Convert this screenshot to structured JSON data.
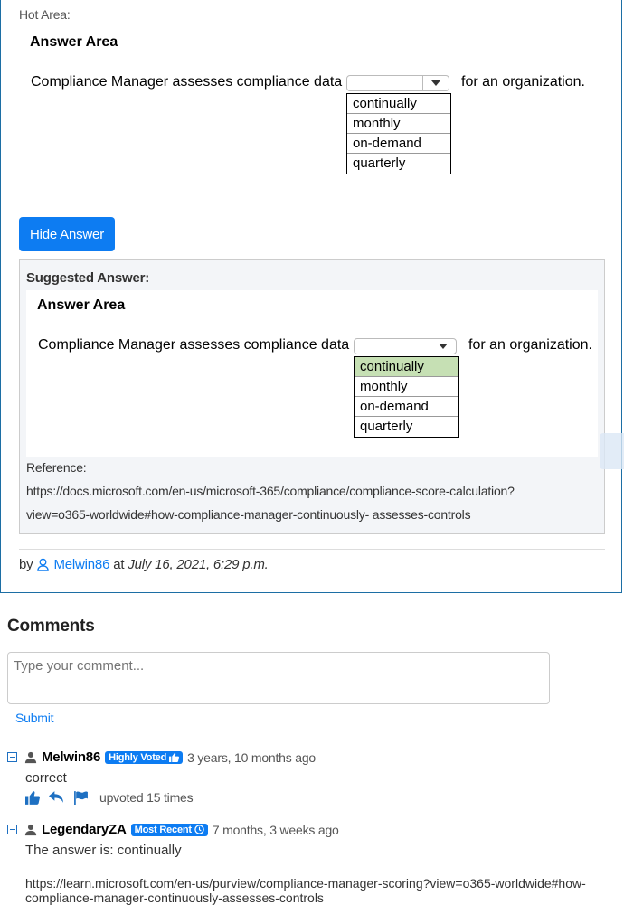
{
  "question": {
    "hot_area_label": "Hot Area:",
    "answer_area_title": "Answer Area",
    "sentence_before": "Compliance Manager assesses compliance data",
    "sentence_after": "for an organization.",
    "options": [
      "continually",
      "monthly",
      "on-demand",
      "quarterly"
    ]
  },
  "hide_answer_button": "Hide Answer",
  "suggested": {
    "label": "Suggested Answer:",
    "answer_area_title": "Answer Area",
    "sentence_before": "Compliance Manager assesses compliance data",
    "sentence_after": "for an organization.",
    "options": [
      "continually",
      "monthly",
      "on-demand",
      "quarterly"
    ],
    "selected": "continually",
    "reference_label": "Reference:",
    "reference_line1": "https://docs.microsoft.com/en-us/microsoft-365/compliance/compliance-score-calculation?",
    "reference_line2": "view=o365-worldwide#how-compliance-manager-continuously- assesses-controls"
  },
  "author": {
    "by": "by",
    "user": "Melwin86",
    "at": "at",
    "date": "July 16, 2021, 6:29 p.m."
  },
  "comments": {
    "heading": "Comments",
    "placeholder": "Type your comment...",
    "submit": "Submit",
    "items": [
      {
        "user": "Melwin86",
        "badge": "Highly Voted",
        "time": "3 years, 10 months ago",
        "text": "correct",
        "upvotes": "upvoted 15 times"
      },
      {
        "user": "LegendaryZA",
        "badge": "Most Recent",
        "time": "7 months, 3 weeks ago",
        "text": "The answer is: continually",
        "link_line1": "https://learn.microsoft.com/en-us/purview/compliance-manager-scoring?view=o365-worldwide#how-",
        "link_line2": "compliance-manager-continuously-assesses-controls"
      }
    ]
  },
  "colors": {
    "accent": "#0d7cf2",
    "selected_option": "#c6e0b4"
  }
}
